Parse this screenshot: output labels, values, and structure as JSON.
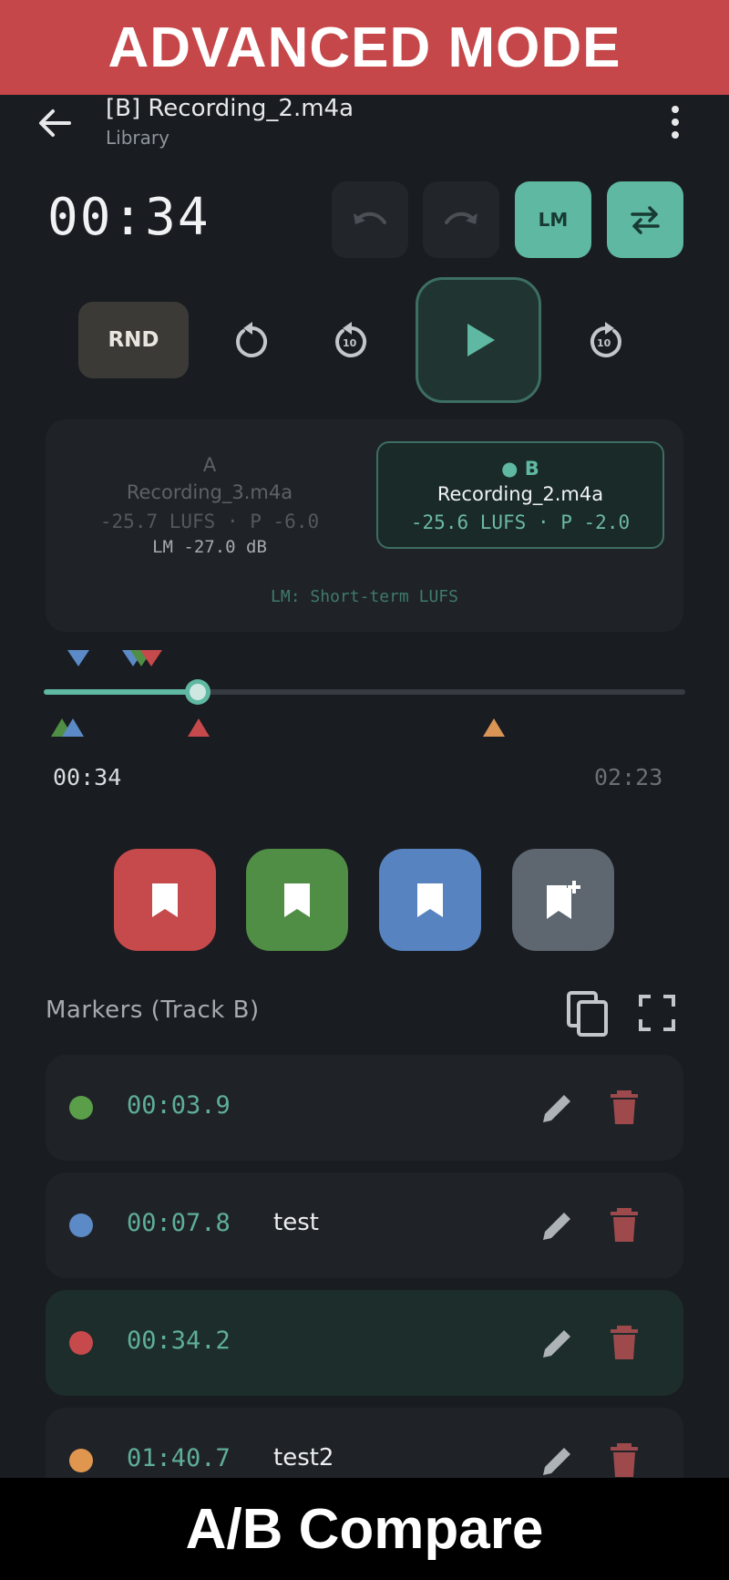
{
  "banner": {
    "top": "ADVANCED MODE",
    "bottom": "A/B Compare"
  },
  "appbar": {
    "title": "[B] Recording_2.m4a",
    "subtitle": "Library"
  },
  "player": {
    "timer": "00:34",
    "lm_label": "LM",
    "rnd_label": "RND",
    "skip_seconds": "10"
  },
  "compare": {
    "a": {
      "letter": "A",
      "name": "Recording_3.m4a",
      "lufs": "-25.7 LUFS · P -6.0",
      "lm": "LM -27.0 dB"
    },
    "b": {
      "letter": "● B",
      "name": "Recording_2.m4a",
      "lufs": "-25.6 LUFS · P -2.0"
    },
    "note": "LM: Short-term LUFS"
  },
  "seek": {
    "current": "00:34",
    "total": "02:23",
    "progress": 0.24
  },
  "colors": {
    "accent": "#5fb8a2",
    "red": "#c6494b",
    "green": "#4f8e44",
    "blue": "#5783c0",
    "orange": "#d99456",
    "gray": "#5e6670"
  },
  "markers": {
    "heading": "Markers (Track B)",
    "items": [
      {
        "color": "#5a9e4a",
        "time": "00:03.9",
        "label": ""
      },
      {
        "color": "#5b8ac7",
        "time": "00:07.8",
        "label": "test"
      },
      {
        "color": "#c6494b",
        "time": "00:34.2",
        "label": ""
      },
      {
        "color": "#e0964f",
        "time": "01:40.7",
        "label": "test2"
      }
    ]
  }
}
